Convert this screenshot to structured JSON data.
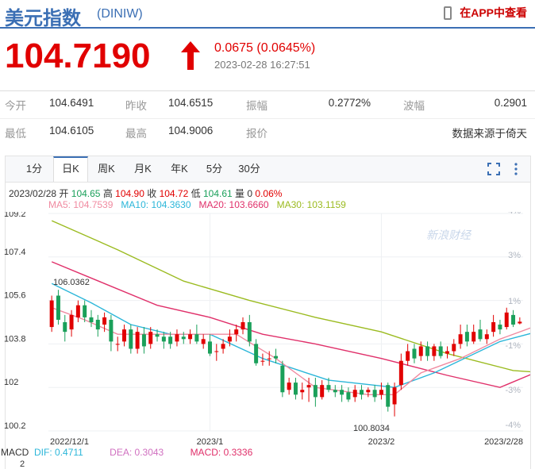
{
  "header": {
    "name": "美元指数",
    "code": "(DINIW)",
    "app_link": "在APP中查看"
  },
  "quote": {
    "price": "104.7190",
    "change": "0.0675 (0.0645%)",
    "time": "2023-02-28 16:27:51"
  },
  "stats": {
    "open_label": "今开",
    "open": "104.6491",
    "prev_close_label": "昨收",
    "prev_close": "104.6515",
    "amplitude_label": "振幅",
    "amplitude": "0.2772%",
    "wave_label": "波幅",
    "wave": "0.2901",
    "low_label": "最低",
    "low": "104.6105",
    "high_label": "最高",
    "high": "104.9006",
    "quote_label": "报价",
    "source": "数据来源于倚天"
  },
  "tabs": [
    "1分",
    "日K",
    "周K",
    "月K",
    "年K",
    "5分",
    "30分"
  ],
  "active_tab": "日K",
  "bar_info": {
    "date": "2023/02/28",
    "open_label": "开",
    "open": "104.65",
    "high_label": "高",
    "high": "104.90",
    "close_label": "收",
    "close": "104.72",
    "low_label": "低",
    "low": "104.61",
    "vol_label": "量",
    "vol": "0",
    "pct": "0.06%"
  },
  "ma_legend": {
    "ma5": "MA5: 104.7539",
    "ma10": "MA10: 104.3630",
    "ma20": "MA20: 103.6660",
    "ma30": "MA30: 103.1159"
  },
  "macd": {
    "label": "MACD",
    "dif": "DIF: 0.4711",
    "dea": "DEA: 0.3043",
    "macd": "MACD: 0.3336",
    "axis_value": "2"
  },
  "colors": {
    "up": "#e10000",
    "down": "#1aa05a",
    "ma5": "#f08aa0",
    "ma10": "#2bb6d9",
    "ma20": "#e0306a",
    "ma30": "#9bbb20",
    "brand": "#3b6fb4"
  },
  "chart_data": {
    "type": "candlestick",
    "y_ticks": [
      "109.2",
      "107.4",
      "105.6",
      "103.8",
      "102",
      "100.2"
    ],
    "pct_ticks": [
      "4%",
      "3%",
      "1%",
      "-1%",
      "-3%",
      "-4%"
    ],
    "x_labels": [
      "2022/12/1",
      "2023/1",
      "2023/2",
      "2023/2/28"
    ],
    "annotations": {
      "max": "106.0362",
      "min": "100.8034"
    },
    "watermark": "新浪财经",
    "ylim": [
      100.2,
      109.2
    ],
    "candles": [
      [
        104.5,
        105.6,
        105.8,
        104.3
      ],
      [
        105.8,
        104.8,
        106.04,
        104.6
      ],
      [
        104.7,
        104.3,
        105.0,
        103.9
      ],
      [
        104.4,
        105.0,
        105.2,
        104.1
      ],
      [
        104.9,
        105.4,
        105.6,
        104.7
      ],
      [
        105.4,
        104.9,
        105.6,
        104.7
      ],
      [
        104.9,
        104.7,
        105.2,
        104.5
      ],
      [
        104.8,
        104.4,
        105.0,
        104.1
      ],
      [
        104.6,
        104.9,
        105.1,
        104.3
      ],
      [
        104.8,
        103.9,
        105.0,
        103.5
      ],
      [
        103.8,
        103.8,
        104.1,
        103.5
      ],
      [
        103.9,
        104.4,
        104.6,
        103.7
      ],
      [
        104.4,
        103.6,
        104.6,
        103.4
      ],
      [
        103.6,
        104.3,
        104.5,
        103.4
      ],
      [
        104.2,
        103.7,
        104.5,
        103.4
      ],
      [
        103.8,
        104.3,
        104.5,
        103.6
      ],
      [
        104.2,
        104.1,
        104.4,
        103.9
      ],
      [
        104.1,
        103.9,
        104.3,
        103.6
      ],
      [
        104.1,
        103.8,
        104.3,
        103.6
      ],
      [
        103.9,
        104.2,
        104.4,
        103.7
      ],
      [
        104.1,
        104.0,
        104.3,
        103.8
      ],
      [
        104.0,
        104.2,
        104.4,
        103.8
      ],
      [
        104.2,
        103.9,
        104.6,
        103.8
      ],
      [
        103.8,
        104.0,
        104.2,
        103.6
      ],
      [
        103.9,
        103.4,
        104.2,
        103.3
      ],
      [
        103.5,
        103.5,
        103.8,
        103.1
      ],
      [
        103.6,
        103.8,
        104.0,
        103.4
      ],
      [
        103.9,
        104.1,
        104.4,
        103.7
      ],
      [
        104.2,
        104.4,
        104.6,
        103.9
      ],
      [
        104.4,
        104.7,
        104.9,
        104.2
      ],
      [
        104.7,
        103.9,
        105.0,
        103.7
      ],
      [
        103.8,
        103.0,
        104.0,
        102.9
      ],
      [
        103.1,
        103.1,
        103.4,
        102.9
      ],
      [
        103.2,
        103.2,
        103.5,
        102.9
      ],
      [
        103.3,
        103.2,
        103.6,
        103.0
      ],
      [
        102.9,
        101.8,
        103.1,
        101.6
      ],
      [
        101.9,
        102.2,
        102.4,
        101.7
      ],
      [
        102.2,
        101.7,
        102.4,
        101.5
      ],
      [
        101.8,
        101.9,
        102.2,
        101.5
      ],
      [
        102.0,
        102.1,
        102.4,
        101.4
      ],
      [
        102.1,
        101.6,
        102.4,
        101.2
      ],
      [
        101.6,
        102.1,
        102.3,
        101.5
      ],
      [
        102.1,
        101.9,
        102.4,
        101.8
      ],
      [
        101.9,
        101.8,
        102.1,
        101.6
      ],
      [
        101.9,
        101.7,
        102.1,
        101.4
      ],
      [
        101.8,
        101.5,
        102.0,
        101.4
      ],
      [
        101.6,
        101.9,
        102.1,
        101.4
      ],
      [
        101.9,
        101.7,
        102.1,
        101.5
      ],
      [
        101.8,
        101.9,
        102.0,
        101.6
      ],
      [
        101.9,
        101.6,
        102.1,
        101.4
      ],
      [
        101.7,
        101.9,
        102.2,
        101.5
      ],
      [
        102.1,
        101.2,
        102.2,
        101.0
      ],
      [
        101.3,
        102.0,
        102.2,
        100.8
      ],
      [
        102.1,
        103.1,
        103.4,
        101.9
      ],
      [
        103.1,
        103.5,
        103.8,
        102.9
      ],
      [
        103.6,
        103.2,
        103.8,
        103.0
      ],
      [
        103.3,
        103.7,
        103.9,
        103.1
      ],
      [
        103.7,
        103.3,
        103.9,
        103.1
      ],
      [
        103.3,
        103.7,
        103.8,
        103.1
      ],
      [
        103.7,
        103.3,
        103.9,
        103.2
      ],
      [
        103.4,
        103.5,
        103.7,
        103.2
      ],
      [
        103.5,
        103.8,
        104.0,
        103.3
      ],
      [
        103.8,
        104.2,
        104.6,
        103.6
      ],
      [
        104.3,
        103.9,
        104.6,
        103.7
      ],
      [
        103.9,
        104.3,
        104.6,
        103.8
      ],
      [
        104.4,
        104.0,
        104.8,
        103.9
      ],
      [
        104.0,
        104.2,
        104.4,
        103.8
      ],
      [
        104.3,
        104.7,
        105.0,
        104.1
      ],
      [
        104.6,
        104.4,
        104.8,
        104.2
      ],
      [
        104.5,
        105.1,
        105.3,
        104.4
      ],
      [
        105.0,
        104.6,
        105.2,
        104.5
      ],
      [
        104.65,
        104.72,
        104.9,
        104.61
      ]
    ],
    "ma30_points": [
      [
        0,
        108.9
      ],
      [
        10,
        107.7
      ],
      [
        20,
        106.4
      ],
      [
        30,
        105.6
      ],
      [
        40,
        104.9
      ],
      [
        50,
        104.3
      ],
      [
        60,
        103.4
      ],
      [
        70,
        102.7
      ],
      [
        75,
        102.6
      ]
    ],
    "ma20_points": [
      [
        0,
        107.2
      ],
      [
        8,
        106.3
      ],
      [
        16,
        105.4
      ],
      [
        24,
        104.9
      ],
      [
        32,
        104.2
      ],
      [
        40,
        103.8
      ],
      [
        50,
        103.2
      ],
      [
        60,
        102.5
      ],
      [
        68,
        102.0
      ],
      [
        75,
        102.8
      ]
    ],
    "ma10_points": [
      [
        0,
        106.3
      ],
      [
        6,
        105.5
      ],
      [
        12,
        104.6
      ],
      [
        18,
        104.2
      ],
      [
        24,
        104.2
      ],
      [
        32,
        103.2
      ],
      [
        42,
        102.3
      ],
      [
        52,
        102.0
      ],
      [
        58,
        102.6
      ],
      [
        68,
        103.9
      ],
      [
        75,
        104.4
      ]
    ],
    "ma5_points": [
      [
        0,
        105.3
      ],
      [
        5,
        104.8
      ],
      [
        10,
        104.2
      ],
      [
        16,
        104.2
      ],
      [
        22,
        104.2
      ],
      [
        28,
        104.2
      ],
      [
        34,
        103.2
      ],
      [
        40,
        102.0
      ],
      [
        48,
        101.7
      ],
      [
        52,
        101.7
      ],
      [
        56,
        102.6
      ],
      [
        62,
        103.2
      ],
      [
        68,
        104.0
      ],
      [
        75,
        104.7
      ]
    ]
  }
}
